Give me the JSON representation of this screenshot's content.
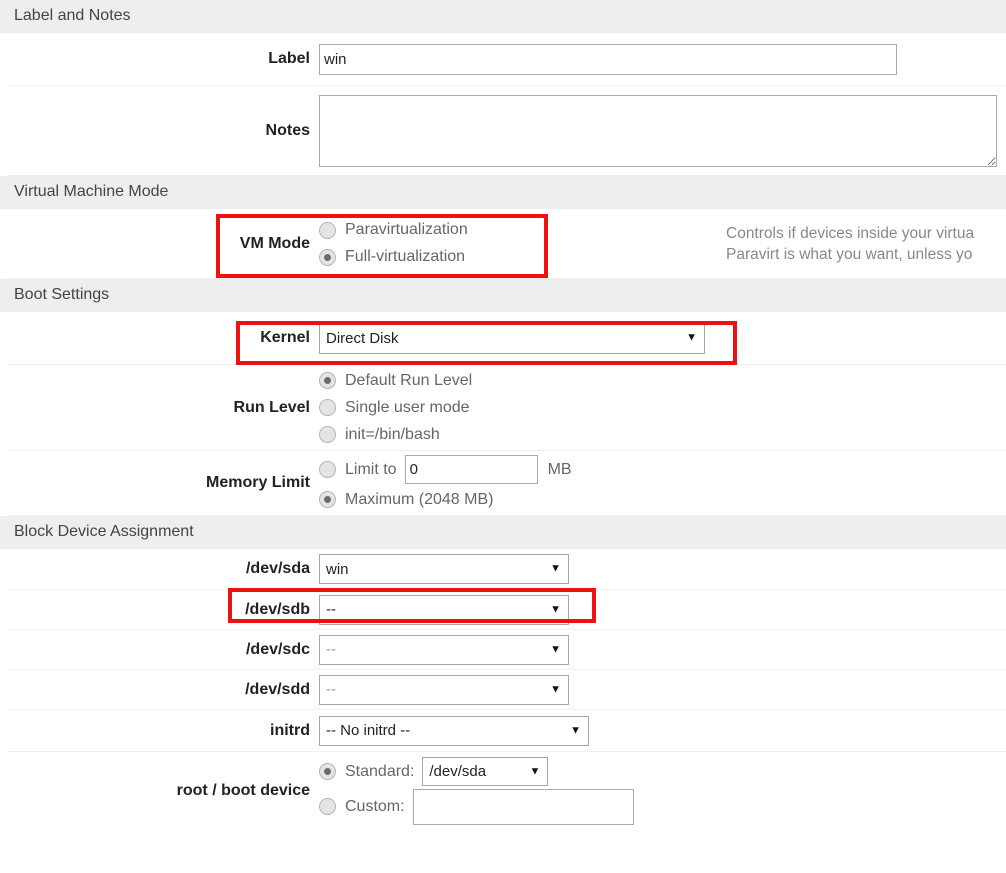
{
  "sections": [
    {
      "title": "Label and Notes"
    },
    {
      "title": "Virtual Machine Mode"
    },
    {
      "title": "Boot Settings"
    },
    {
      "title": "Block Device Assignment"
    }
  ],
  "label_row": {
    "label": "Label",
    "value": "win",
    "placeholder": ""
  },
  "notes_row": {
    "label": "Notes",
    "value": "",
    "placeholder": ""
  },
  "vm_mode": {
    "label": "VM Mode",
    "options": [
      {
        "label": "Paravirtualization",
        "selected": false
      },
      {
        "label": "Full-virtualization",
        "selected": true
      }
    ],
    "help_line1": "Controls if devices inside your virtua",
    "help_line2": "Paravirt is what you want, unless yo"
  },
  "kernel_row": {
    "label": "Kernel",
    "value": "Direct Disk"
  },
  "run_level": {
    "label": "Run Level",
    "options": [
      {
        "label": "Default Run Level",
        "selected": true
      },
      {
        "label": "Single user mode",
        "selected": false
      },
      {
        "label": "init=/bin/bash",
        "selected": false
      }
    ]
  },
  "memory_limit": {
    "label": "Memory Limit",
    "limit_to_label": "Limit to",
    "limit_value": "0",
    "unit": "MB",
    "limit_selected": false,
    "maximum_label": "Maximum (2048 MB)",
    "maximum_selected": true
  },
  "block_devices": [
    {
      "label": "/dev/sda",
      "value": "win",
      "disabled": false
    },
    {
      "label": "/dev/sdb",
      "value": "--",
      "disabled": false
    },
    {
      "label": "/dev/sdc",
      "value": "--",
      "disabled": true
    },
    {
      "label": "/dev/sdd",
      "value": "--",
      "disabled": true
    }
  ],
  "initrd_row": {
    "label": "initrd",
    "value": "-- No initrd --"
  },
  "root_boot": {
    "label": "root / boot device",
    "standard_label": "Standard:",
    "standard_value": "/dev/sda",
    "standard_selected": true,
    "custom_label": "Custom:",
    "custom_value": "",
    "custom_selected": false
  },
  "icons": {
    "chevron_down": "▼",
    "resize_grip": "resize-grip-icon"
  },
  "colors": {
    "annotation_red": "#ee1111",
    "section_header_bg": "#eeeeee",
    "row_divider": "#efefef"
  }
}
